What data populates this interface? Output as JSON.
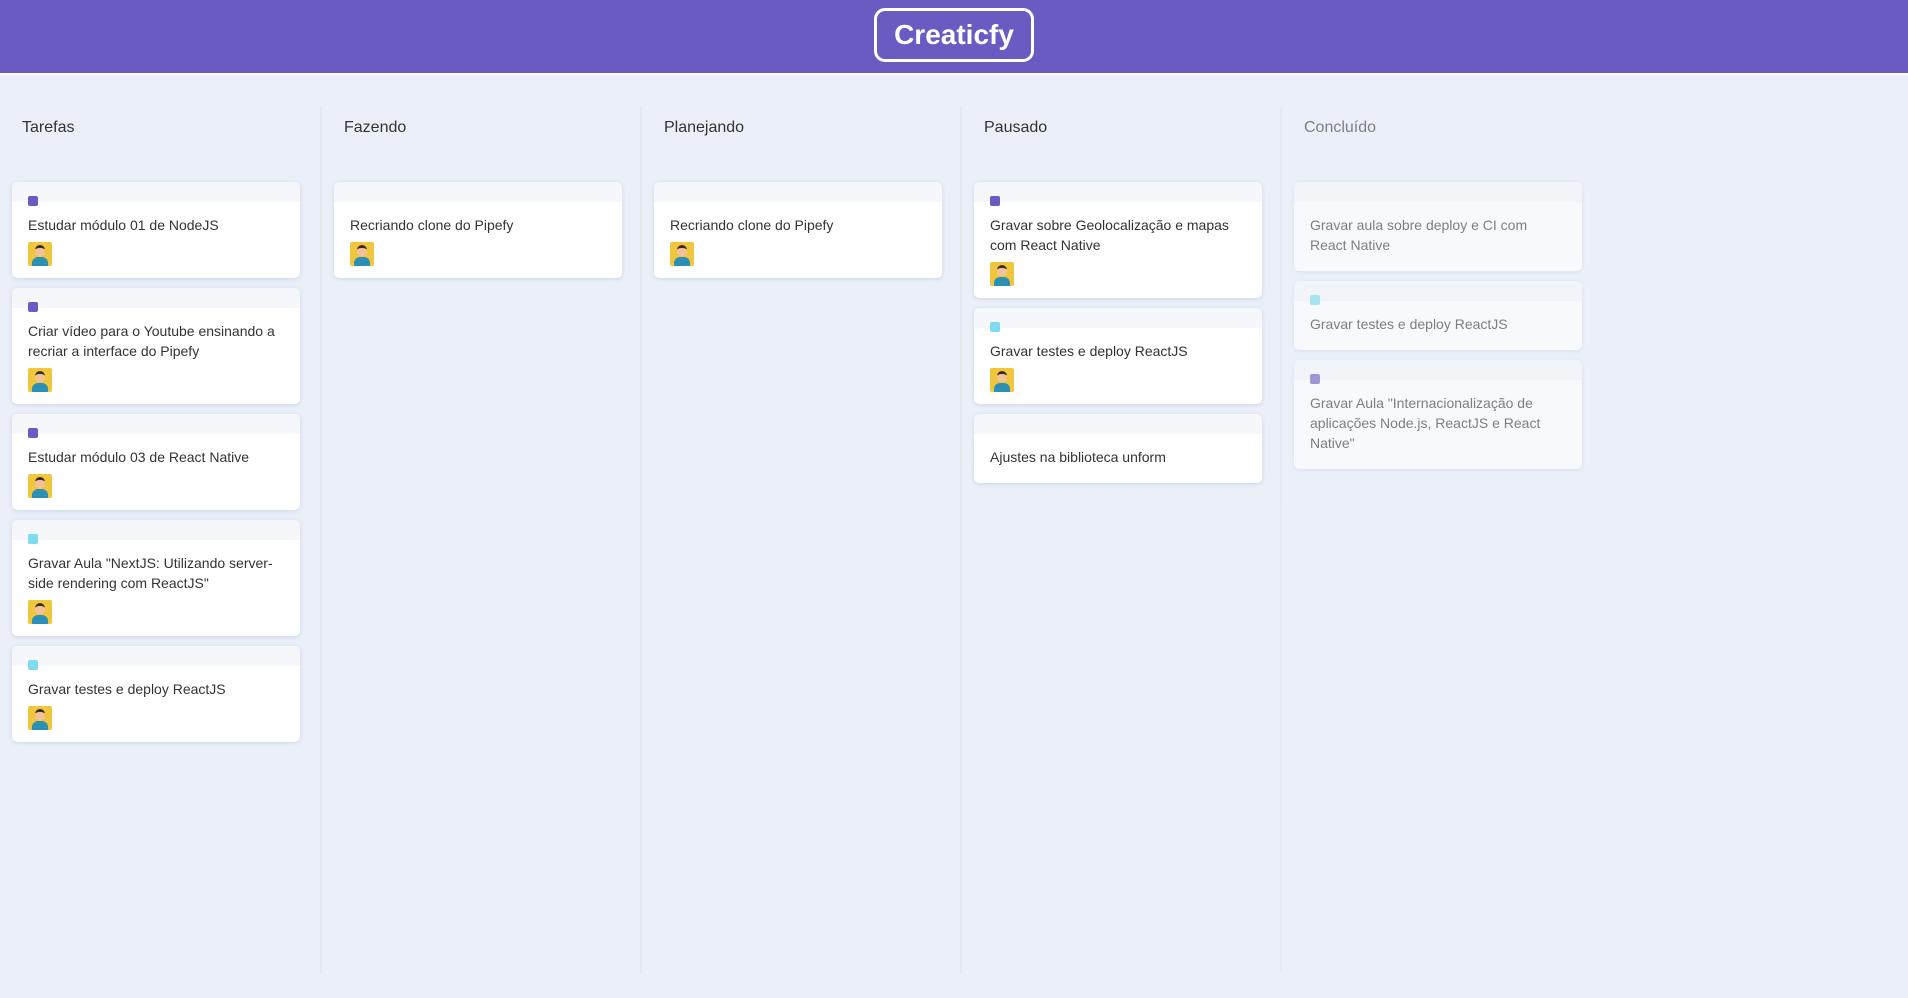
{
  "header": {
    "logo": "Creaticfy"
  },
  "colors": {
    "header": "#6a5bc2",
    "label_purple": "#6a5bc2",
    "label_cyan": "#7ddcf0",
    "background": "#ebf0f8"
  },
  "lists": [
    {
      "title": "Tarefas",
      "cards": [
        {
          "label": "#6a5bc2",
          "content": "Estudar módulo 01 de NodeJS",
          "user": "avatar"
        },
        {
          "label": "#6a5bc2",
          "content": "Criar vídeo para o Youtube ensinando a recriar a interface do Pipefy",
          "user": "avatar"
        },
        {
          "label": "#6a5bc2",
          "content": "Estudar módulo 03 de React Native",
          "user": "avatar"
        },
        {
          "label": "#7ddcf0",
          "content": "Gravar Aula \"NextJS: Utilizando server-side rendering com ReactJS\"",
          "user": "avatar"
        },
        {
          "label": "#7ddcf0",
          "content": "Gravar testes e deploy ReactJS",
          "user": "avatar"
        }
      ]
    },
    {
      "title": "Fazendo",
      "cards": [
        {
          "label": "",
          "content": "Recriando clone do Pipefy",
          "user": "avatar"
        }
      ]
    },
    {
      "title": "Planejando",
      "cards": [
        {
          "label": "",
          "content": "Recriando clone do Pipefy",
          "user": "avatar"
        }
      ]
    },
    {
      "title": "Pausado",
      "cards": [
        {
          "label": "#6a5bc2",
          "content": "Gravar sobre Geolocalização e mapas com React Native",
          "user": "avatar"
        },
        {
          "label": "#7ddcf0",
          "content": "Gravar testes e deploy ReactJS",
          "user": "avatar"
        },
        {
          "label": "",
          "content": "Ajustes na biblioteca unform",
          "user": ""
        }
      ]
    },
    {
      "title": "Concluído",
      "done": true,
      "cards": [
        {
          "label": "",
          "content": "Gravar aula sobre deploy e CI com React Native",
          "user": ""
        },
        {
          "label": "#7ddcf0",
          "content": "Gravar testes e deploy ReactJS",
          "user": ""
        },
        {
          "label": "#6a5bc2",
          "content": "Gravar Aula \"Internacionalização de aplicações Node.js, ReactJS e React Native\"",
          "user": ""
        }
      ]
    }
  ]
}
